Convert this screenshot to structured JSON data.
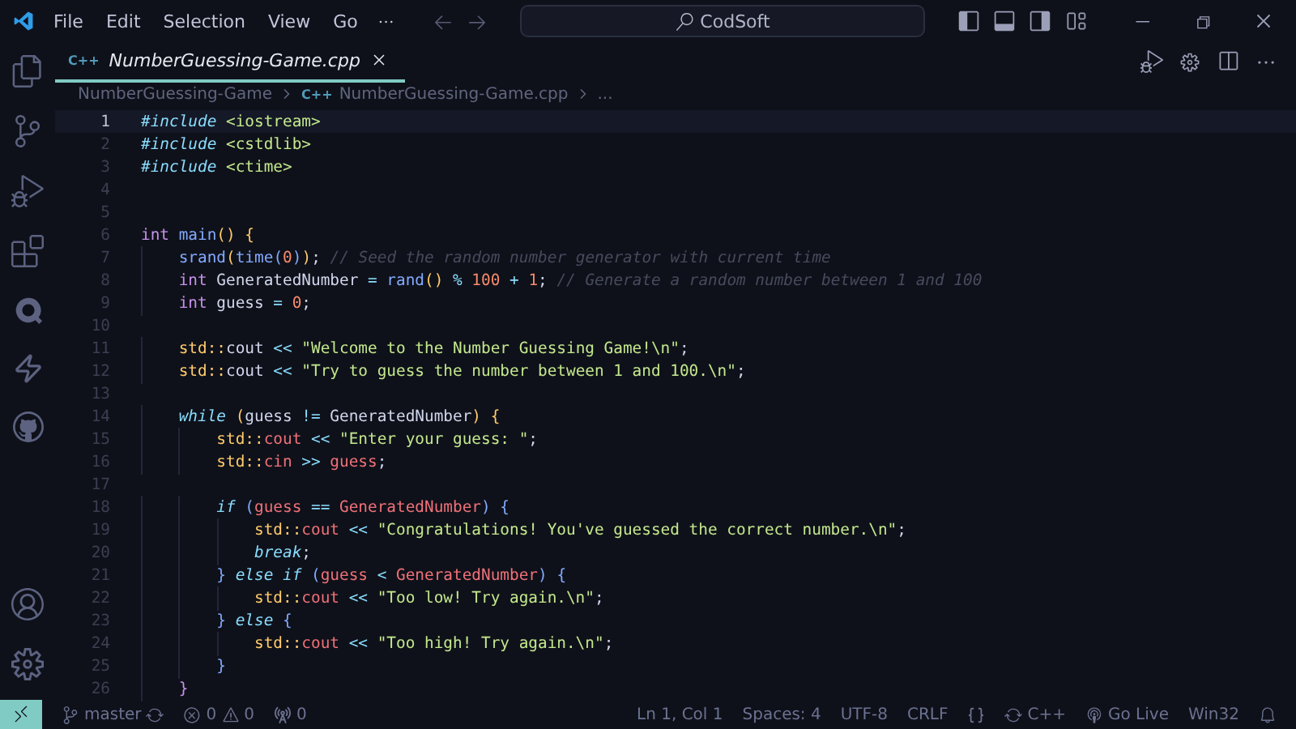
{
  "menu": [
    "File",
    "Edit",
    "Selection",
    "View",
    "Go"
  ],
  "search": {
    "value": "CodSoft"
  },
  "tabs": [
    {
      "icon_text": "C++",
      "label": "NumberGuessing-Game.cpp",
      "selected": true
    }
  ],
  "breadcrumbs": [
    {
      "text": "NumberGuessing-Game"
    },
    {
      "icon_text": "C++",
      "text": "NumberGuessing-Game.cpp"
    },
    {
      "text": "..."
    }
  ],
  "lines": [
    {
      "number": "1",
      "current": true,
      "tokens": [
        {
          "kind": "directive",
          "text": "#include"
        },
        {
          "kind": "header",
          "text": " <iostream>"
        }
      ]
    },
    {
      "number": "2",
      "current": false,
      "tokens": [
        {
          "kind": "directive",
          "text": "#include"
        },
        {
          "kind": "header",
          "text": " <cstdlib>"
        }
      ]
    },
    {
      "number": "3",
      "current": false,
      "tokens": [
        {
          "kind": "directive",
          "text": "#include"
        },
        {
          "kind": "header",
          "text": " <ctime>"
        }
      ]
    },
    {
      "number": "4",
      "current": false
    },
    {
      "number": "5",
      "current": false
    },
    {
      "number": "6",
      "current": false,
      "tokens": [
        {
          "kind": "type",
          "text": "int"
        },
        {
          "kind": "func",
          "text": " main"
        },
        {
          "kind": "paren",
          "text": "()"
        },
        {
          "kind": "brace",
          "text": " {"
        }
      ]
    },
    {
      "number": "7",
      "current": false,
      "tokens": [
        {
          "kind": "func",
          "text": "    srand"
        },
        {
          "kind": "paren",
          "text": "("
        },
        {
          "kind": "func",
          "text": "time"
        },
        {
          "kind": "paren2",
          "text": "("
        },
        {
          "kind": "num",
          "text": "0"
        },
        {
          "kind": "paren2",
          "text": ")"
        },
        {
          "kind": "paren",
          "text": ")"
        },
        {
          "kind": "plain",
          "text": ";"
        },
        {
          "kind": "comment",
          "text": " // Seed the random number generator with current time"
        }
      ]
    },
    {
      "number": "8",
      "current": false,
      "tokens": [
        {
          "kind": "type",
          "text": "    int"
        },
        {
          "kind": "plain",
          "text": " GeneratedNumber "
        },
        {
          "kind": "op",
          "text": "="
        },
        {
          "kind": "func",
          "text": " rand"
        },
        {
          "kind": "paren",
          "text": "()"
        },
        {
          "kind": "op",
          "text": " %"
        },
        {
          "kind": "num",
          "text": " 100"
        },
        {
          "kind": "op",
          "text": " +"
        },
        {
          "kind": "num",
          "text": " 1"
        },
        {
          "kind": "plain",
          "text": ";"
        },
        {
          "kind": "comment",
          "text": " // Generate a random number between 1 and 100"
        }
      ]
    },
    {
      "number": "9",
      "current": false,
      "tokens": [
        {
          "kind": "type",
          "text": "    int"
        },
        {
          "kind": "plain",
          "text": " guess "
        },
        {
          "kind": "op",
          "text": "="
        },
        {
          "kind": "num",
          "text": " 0"
        },
        {
          "kind": "plain",
          "text": ";"
        }
      ]
    },
    {
      "number": "10",
      "current": false
    },
    {
      "number": "11",
      "current": false,
      "tokens": [
        {
          "kind": "ns",
          "text": "    std::"
        },
        {
          "kind": "plain",
          "text": "cout "
        },
        {
          "kind": "op",
          "text": "<<"
        },
        {
          "kind": "str",
          "text": " \"Welcome to the Number Guessing Game!\\n\""
        },
        {
          "kind": "plain",
          "text": ";"
        }
      ]
    },
    {
      "number": "12",
      "current": false,
      "tokens": [
        {
          "kind": "ns",
          "text": "    std::"
        },
        {
          "kind": "plain",
          "text": "cout "
        },
        {
          "kind": "op",
          "text": "<<"
        },
        {
          "kind": "str",
          "text": " \"Try to guess the number between 1 and 100.\\n\""
        },
        {
          "kind": "plain",
          "text": ";"
        }
      ]
    },
    {
      "number": "13",
      "current": false
    },
    {
      "number": "14",
      "current": false,
      "tokens": [
        {
          "kind": "control",
          "text": "    while"
        },
        {
          "kind": "paren",
          "text": " ("
        },
        {
          "kind": "plain",
          "text": "guess "
        },
        {
          "kind": "op",
          "text": "!="
        },
        {
          "kind": "plain",
          "text": " GeneratedNumber"
        },
        {
          "kind": "paren",
          "text": ")"
        },
        {
          "kind": "brace",
          "text": " {"
        }
      ]
    },
    {
      "number": "15",
      "current": false,
      "tokens": [
        {
          "kind": "ns",
          "text": "        std::"
        },
        {
          "kind": "var",
          "text": "cout "
        },
        {
          "kind": "op",
          "text": "<<"
        },
        {
          "kind": "str",
          "text": " \"Enter your guess: \""
        },
        {
          "kind": "plain",
          "text": ";"
        }
      ]
    },
    {
      "number": "16",
      "current": false,
      "tokens": [
        {
          "kind": "ns",
          "text": "        std::"
        },
        {
          "kind": "var",
          "text": "cin "
        },
        {
          "kind": "op",
          "text": ">>"
        },
        {
          "kind": "var",
          "text": " guess"
        },
        {
          "kind": "plain",
          "text": ";"
        }
      ]
    },
    {
      "number": "17",
      "current": false
    },
    {
      "number": "18",
      "current": false,
      "tokens": [
        {
          "kind": "control",
          "text": "        if"
        },
        {
          "kind": "paren2",
          "text": " ("
        },
        {
          "kind": "var",
          "text": "guess "
        },
        {
          "kind": "op",
          "text": "=="
        },
        {
          "kind": "var",
          "text": " GeneratedNumber"
        },
        {
          "kind": "paren2",
          "text": ")"
        },
        {
          "kind": "paren2",
          "text": " {"
        }
      ]
    },
    {
      "number": "19",
      "current": false,
      "tokens": [
        {
          "kind": "ns",
          "text": "            std::"
        },
        {
          "kind": "var",
          "text": "cout "
        },
        {
          "kind": "op",
          "text": "<<"
        },
        {
          "kind": "str",
          "text": " \"Congratulations! You've guessed the correct number.\\n\""
        },
        {
          "kind": "plain",
          "text": ";"
        }
      ]
    },
    {
      "number": "20",
      "current": false,
      "tokens": [
        {
          "kind": "control",
          "text": "            break"
        },
        {
          "kind": "plain",
          "text": ";"
        }
      ]
    },
    {
      "number": "21",
      "current": false,
      "tokens": [
        {
          "kind": "paren2",
          "text": "        }"
        },
        {
          "kind": "control",
          "text": " else if"
        },
        {
          "kind": "paren2",
          "text": " ("
        },
        {
          "kind": "var",
          "text": "guess "
        },
        {
          "kind": "op",
          "text": "<"
        },
        {
          "kind": "var",
          "text": " GeneratedNumber"
        },
        {
          "kind": "paren2",
          "text": ")"
        },
        {
          "kind": "paren2",
          "text": " {"
        }
      ]
    },
    {
      "number": "22",
      "current": false,
      "tokens": [
        {
          "kind": "ns",
          "text": "            std::"
        },
        {
          "kind": "var",
          "text": "cout "
        },
        {
          "kind": "op",
          "text": "<<"
        },
        {
          "kind": "str",
          "text": " \"Too low! Try again.\\n\""
        },
        {
          "kind": "plain",
          "text": ";"
        }
      ]
    },
    {
      "number": "23",
      "current": false,
      "tokens": [
        {
          "kind": "paren2",
          "text": "        }"
        },
        {
          "kind": "control",
          "text": " else"
        },
        {
          "kind": "paren2",
          "text": " {"
        }
      ]
    },
    {
      "number": "24",
      "current": false,
      "tokens": [
        {
          "kind": "ns",
          "text": "            std::"
        },
        {
          "kind": "var",
          "text": "cout "
        },
        {
          "kind": "op",
          "text": "<<"
        },
        {
          "kind": "str",
          "text": " \"Too high! Try again.\\n\""
        },
        {
          "kind": "plain",
          "text": ";"
        }
      ]
    },
    {
      "number": "25",
      "current": false,
      "tokens": [
        {
          "kind": "paren2",
          "text": "        }"
        }
      ]
    },
    {
      "number": "26",
      "current": false,
      "tokens": [
        {
          "kind": "brace2",
          "text": "    }"
        }
      ]
    }
  ],
  "status_bar": {
    "branch": "master",
    "errors": "0",
    "warnings": "0",
    "ports": "0",
    "position": "Ln 1, Col 1",
    "indent": "Spaces: 4",
    "encoding": "UTF-8",
    "eol": "CRLF",
    "language": "C++",
    "live": "Go Live",
    "platform": "Win32"
  }
}
